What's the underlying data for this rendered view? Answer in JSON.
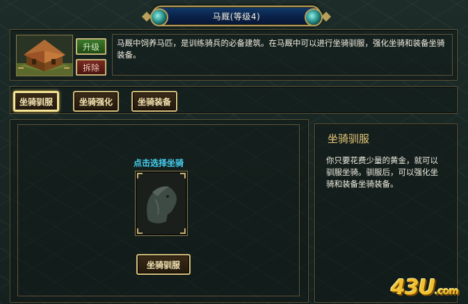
{
  "window": {
    "title": "马厩(等级4)"
  },
  "building": {
    "upgrade_label": "升级",
    "demolish_label": "拆除",
    "description": "马厩中饲养马匹，是训练骑兵的必备建筑。在马厩中可以进行坐骑驯服，强化坐骑和装备坐骑装备。"
  },
  "tabs": [
    {
      "label": "坐骑驯服",
      "active": true
    },
    {
      "label": "坐骑强化",
      "active": false
    },
    {
      "label": "坐骑装备",
      "active": false
    }
  ],
  "tame_panel": {
    "select_label": "点击选择坐骑",
    "action_label": "坐骑驯服"
  },
  "info_panel": {
    "title": "坐骑驯服",
    "text": "你只要花费少量的黄金，就可以驯服坐骑。驯服后，可以强化坐骑和装备坐骑装备。"
  },
  "watermark": {
    "main": "43U",
    "suffix": ".com"
  },
  "colors": {
    "accent_gold": "#d9c07a",
    "select_cyan": "#46d0f0",
    "title_gold": "#e8c878"
  }
}
